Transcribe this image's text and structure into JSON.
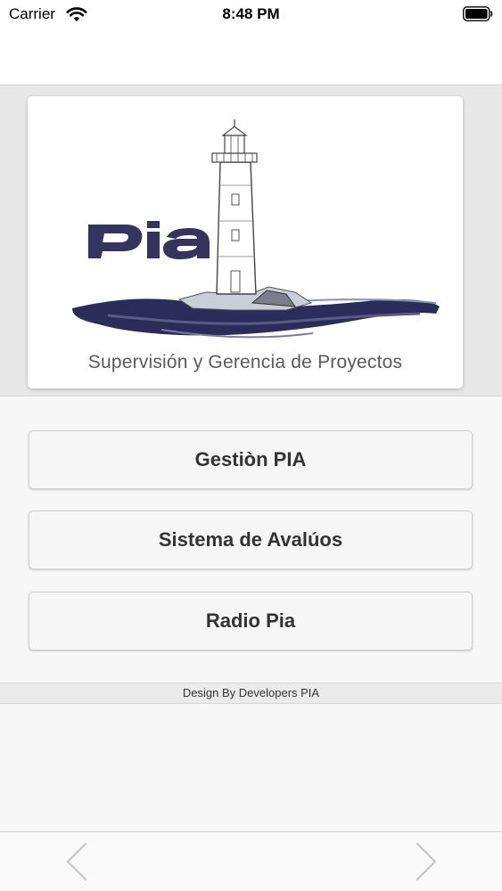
{
  "status_bar": {
    "carrier": "Carrier",
    "time": "8:48 PM",
    "wifi_icon": "wifi-icon",
    "battery_icon": "battery-icon"
  },
  "logo": {
    "brand_text": "PIA",
    "tagline": "Supervisión y Gerencia de Proyectos",
    "brand_color": "#34345e"
  },
  "menu": {
    "items": [
      {
        "label": "Gestiòn PIA"
      },
      {
        "label": "Sistema de Avalúos"
      },
      {
        "label": "Radio Pia"
      }
    ]
  },
  "footer": {
    "credit": "Design By Developers PIA"
  },
  "toolbar": {
    "back_icon": "chevron-left-icon",
    "forward_icon": "chevron-right-icon"
  }
}
